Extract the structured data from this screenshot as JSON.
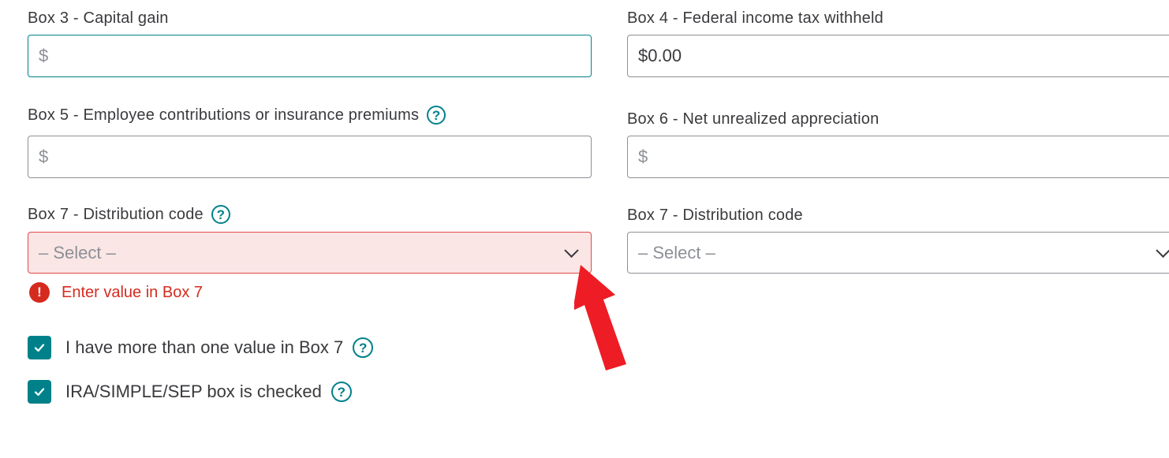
{
  "left": {
    "box3": {
      "label": "Box 3 - Capital gain",
      "placeholder": "$"
    },
    "box5": {
      "label": "Box 5 - Employee contributions or insurance premiums",
      "placeholder": "$"
    },
    "box7": {
      "label": "Box 7 - Distribution code",
      "placeholder": "– Select –",
      "error": "Enter value in Box 7"
    }
  },
  "right": {
    "box4": {
      "label": "Box 4 - Federal income tax withheld",
      "value": "$0.00"
    },
    "box6": {
      "label": "Box 6 - Net unrealized appreciation",
      "placeholder": "$"
    },
    "box7": {
      "label": "Box 7 - Distribution code",
      "placeholder": "– Select –"
    }
  },
  "checkboxes": [
    {
      "label": "I have more than one value in Box 7",
      "checked": true
    },
    {
      "label": "IRA/SIMPLE/SEP box is checked",
      "checked": true
    }
  ],
  "icons": {
    "help": "?",
    "error": "!"
  },
  "colors": {
    "accent": "#00818a",
    "error": "#d52b1e",
    "error_bg": "#f9e6e5",
    "annotation_arrow": "#ee1c25"
  }
}
